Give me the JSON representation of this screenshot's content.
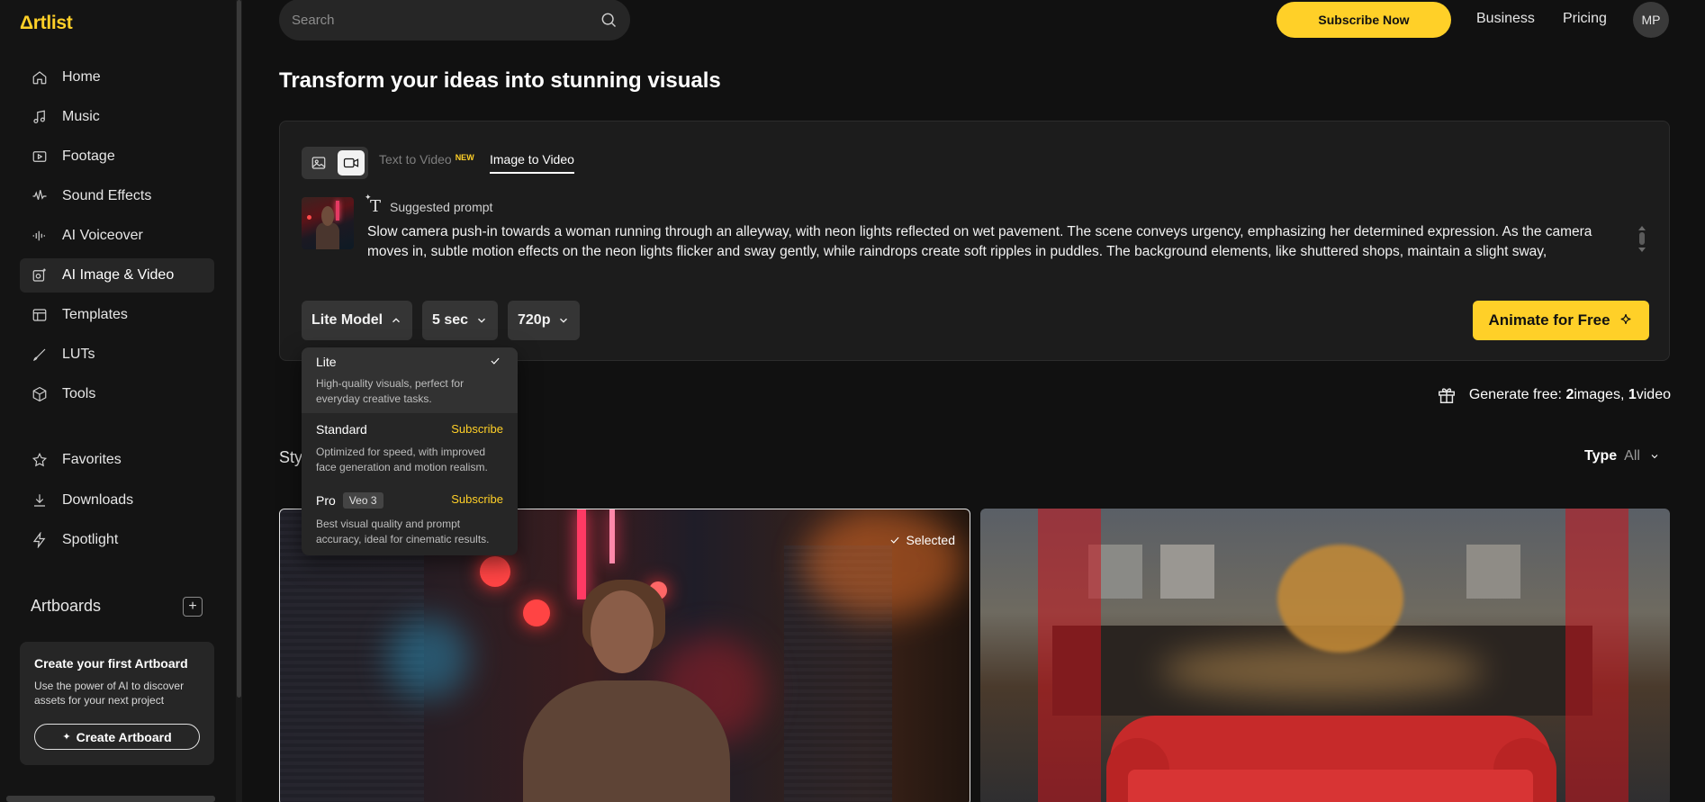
{
  "brand": {
    "logo": "Δrtlist",
    "accent": "#ffd028"
  },
  "sidebar": {
    "items": [
      {
        "label": "Home",
        "icon": "home-icon"
      },
      {
        "label": "Music",
        "icon": "music-note-icon"
      },
      {
        "label": "Footage",
        "icon": "play-box-icon"
      },
      {
        "label": "Sound Effects",
        "icon": "waveform-icon"
      },
      {
        "label": "AI Voiceover",
        "icon": "voice-bars-icon"
      },
      {
        "label": "AI Image & Video",
        "icon": "ai-image-icon",
        "active": true
      },
      {
        "label": "Templates",
        "icon": "template-icon"
      },
      {
        "label": "LUTs",
        "icon": "brush-icon"
      },
      {
        "label": "Tools",
        "icon": "cube-icon"
      },
      {
        "label": "Favorites",
        "icon": "star-icon"
      },
      {
        "label": "Downloads",
        "icon": "download-icon"
      },
      {
        "label": "Spotlight",
        "icon": "lightning-icon"
      }
    ],
    "artboards_title": "Artboards",
    "artboard_card": {
      "title": "Create your first Artboard",
      "text": "Use the power of AI to discover assets for your next project",
      "button": "Create Artboard"
    }
  },
  "topbar": {
    "search_placeholder": "Search",
    "subscribe": "Subscribe Now",
    "business": "Business",
    "pricing": "Pricing",
    "avatar": "MP"
  },
  "page_title": "Transform your ideas into stunning visuals",
  "generator": {
    "tab_text_to_video": "Text to Video",
    "tab_new_badge": "NEW",
    "tab_image_to_video": "Image to Video",
    "suggested_label": "Suggested prompt",
    "prompt": "Slow camera push-in towards a woman running through an alleyway, with neon lights reflected on wet pavement. The scene conveys urgency, emphasizing her determined expression. As the camera moves in, subtle motion effects on the neon lights flicker and sway gently, while raindrops create soft ripples in puddles. The background elements, like shuttered shops, maintain a slight sway,",
    "model": "Lite Model",
    "duration": "5 sec",
    "resolution": "720p",
    "animate": "Animate for Free"
  },
  "model_dropdown": {
    "options": [
      {
        "name": "Lite",
        "desc": "High-quality visuals, perfect for everyday creative tasks.",
        "selected": true
      },
      {
        "name": "Standard",
        "desc": "Optimized for speed, with improved face generation and motion realism.",
        "action": "Subscribe"
      },
      {
        "name": "Pro",
        "badge": "Veo 3",
        "desc": "Best visual quality and prompt accuracy, ideal for cinematic results.",
        "action": "Subscribe"
      }
    ]
  },
  "free_info": {
    "prefix": "Generate free: ",
    "images": "2",
    "images_label": " images, ",
    "videos": "1",
    "videos_label": " video"
  },
  "styles_label": "Sty",
  "type_filter": {
    "label": "Type",
    "value": "All"
  },
  "gallery": {
    "selected_label": "Selected"
  }
}
